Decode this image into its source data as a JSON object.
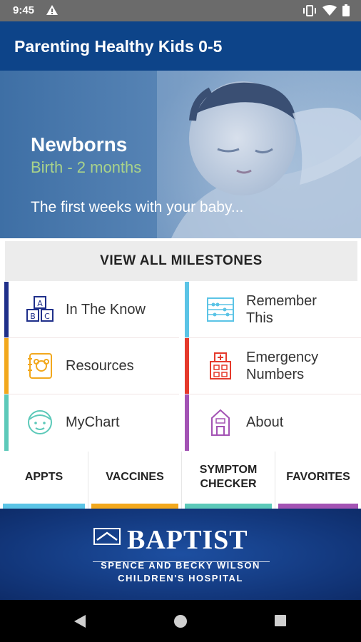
{
  "status_bar": {
    "time": "9:45",
    "icons": [
      "warning-icon",
      "vibrate-icon",
      "wifi-icon",
      "battery-icon"
    ]
  },
  "app_bar": {
    "title": "Parenting Healthy Kids 0-5",
    "color": "#0d4489"
  },
  "hero": {
    "title": "Newborns",
    "subtitle": "Birth - 2 months",
    "description": "The first weeks with your baby..."
  },
  "milestones_button": {
    "label": "VIEW ALL MILESTONES"
  },
  "grid": {
    "items": [
      {
        "label": "In The Know",
        "icon": "abc-blocks-icon",
        "accent": "#1f2f8a"
      },
      {
        "label": "Remember This",
        "icon": "abacus-icon",
        "accent": "#5bc4e6"
      },
      {
        "label": "Resources",
        "icon": "notebook-icon",
        "accent": "#f2a81d"
      },
      {
        "label": "Emergency Numbers",
        "icon": "hospital-icon",
        "accent": "#e53a2c"
      },
      {
        "label": "MyChart",
        "icon": "child-face-icon",
        "accent": "#5cc9b9"
      },
      {
        "label": "About",
        "icon": "building-icon",
        "accent": "#a353b4"
      }
    ]
  },
  "tabs": [
    {
      "label": "APPTS",
      "accent": "#5bc4e6"
    },
    {
      "label": "VACCINES",
      "accent": "#f2a81d"
    },
    {
      "label": "SYMPTOM CHECKER",
      "accent": "#5cc9b9"
    },
    {
      "label": "FAVORITES",
      "accent": "#a353b4"
    }
  ],
  "banner": {
    "brand": "BAPTIST",
    "line1": "SPENCE AND BECKY WILSON",
    "line2": "CHILDREN'S HOSPITAL"
  },
  "nav_bar": {
    "buttons": [
      "back-icon",
      "home-icon",
      "recents-icon"
    ]
  }
}
